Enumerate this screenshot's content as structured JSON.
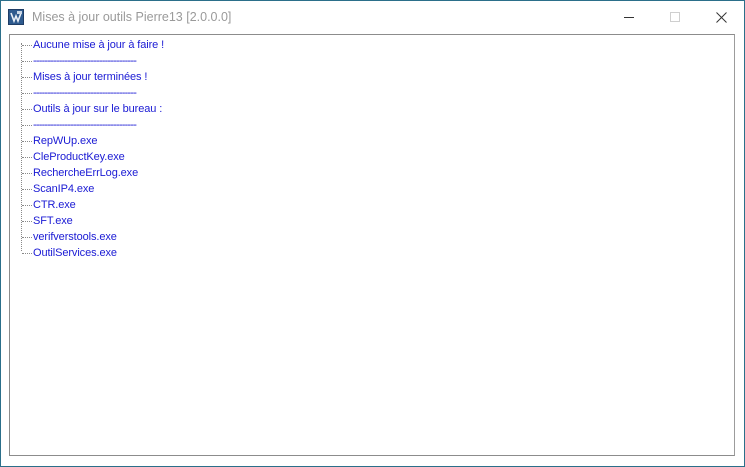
{
  "window": {
    "title": "Mises à jour outils Pierre13 [2.0.0.0]",
    "border_color": "#2b6f8a",
    "app_icon": "app-logo-icon"
  },
  "controls": {
    "minimize_icon": "minimize-icon",
    "maximize_icon": "maximize-icon",
    "close_icon": "close-icon"
  },
  "tree": {
    "text_color": "#1a1ad4",
    "items": [
      {
        "text": "Aucune mise à jour à faire !"
      },
      {
        "text": "------------------------------------"
      },
      {
        "text": "Mises à jour terminées !"
      },
      {
        "text": "------------------------------------"
      },
      {
        "text": "Outils à jour sur le bureau :"
      },
      {
        "text": "------------------------------------"
      },
      {
        "text": "RepWUp.exe"
      },
      {
        "text": "CleProductKey.exe"
      },
      {
        "text": "RechercheErrLog.exe"
      },
      {
        "text": "ScanIP4.exe"
      },
      {
        "text": "CTR.exe"
      },
      {
        "text": "SFT.exe"
      },
      {
        "text": "verifverstools.exe"
      },
      {
        "text": "OutilServices.exe"
      }
    ]
  }
}
